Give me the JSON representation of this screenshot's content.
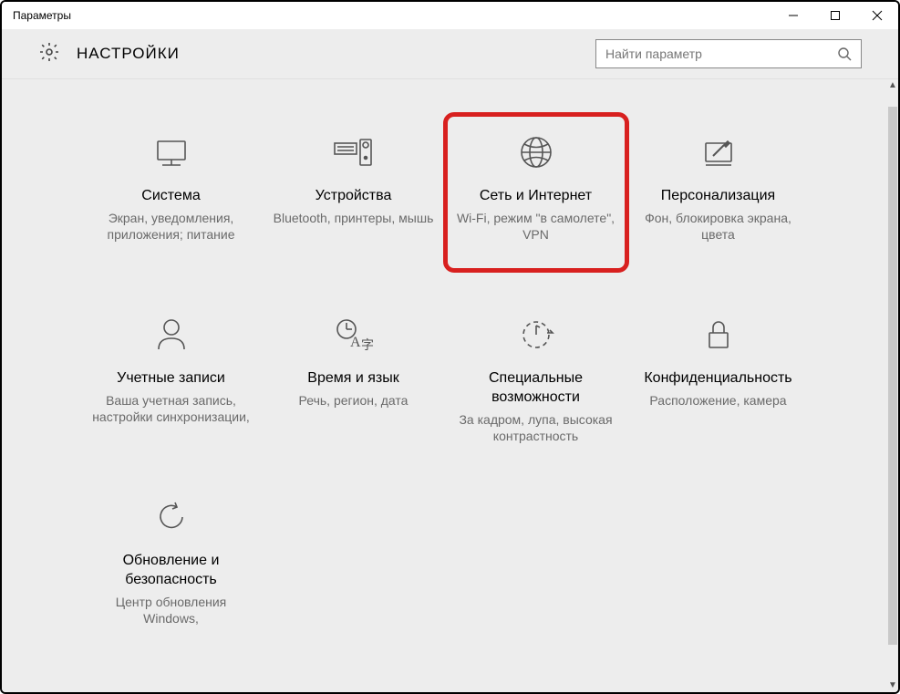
{
  "window": {
    "title": "Параметры"
  },
  "header": {
    "title": "НАСТРОЙКИ"
  },
  "search": {
    "placeholder": "Найти параметр"
  },
  "tiles": [
    {
      "id": "system",
      "title": "Система",
      "desc": "Экран, уведомления, приложения; питание",
      "highlight": false
    },
    {
      "id": "devices",
      "title": "Устройства",
      "desc": "Bluetooth, принтеры, мышь",
      "highlight": false
    },
    {
      "id": "network",
      "title": "Сеть и Интернет",
      "desc": "Wi-Fi, режим \"в самолете\", VPN",
      "highlight": true
    },
    {
      "id": "personalization",
      "title": "Персонализация",
      "desc": "Фон, блокировка экрана, цвета",
      "highlight": false
    },
    {
      "id": "accounts",
      "title": "Учетные записи",
      "desc": "Ваша учетная запись, настройки синхронизации,",
      "highlight": false
    },
    {
      "id": "timelang",
      "title": "Время и язык",
      "desc": "Речь, регион, дата",
      "highlight": false
    },
    {
      "id": "ease",
      "title": "Специальные возможности",
      "desc": "За кадром, лупа, высокая контрастность",
      "highlight": false
    },
    {
      "id": "privacy",
      "title": "Конфиденциальность",
      "desc": "Расположение, камера",
      "highlight": false
    },
    {
      "id": "update",
      "title": "Обновление и безопасность",
      "desc": "Центр обновления Windows,",
      "highlight": false
    }
  ]
}
